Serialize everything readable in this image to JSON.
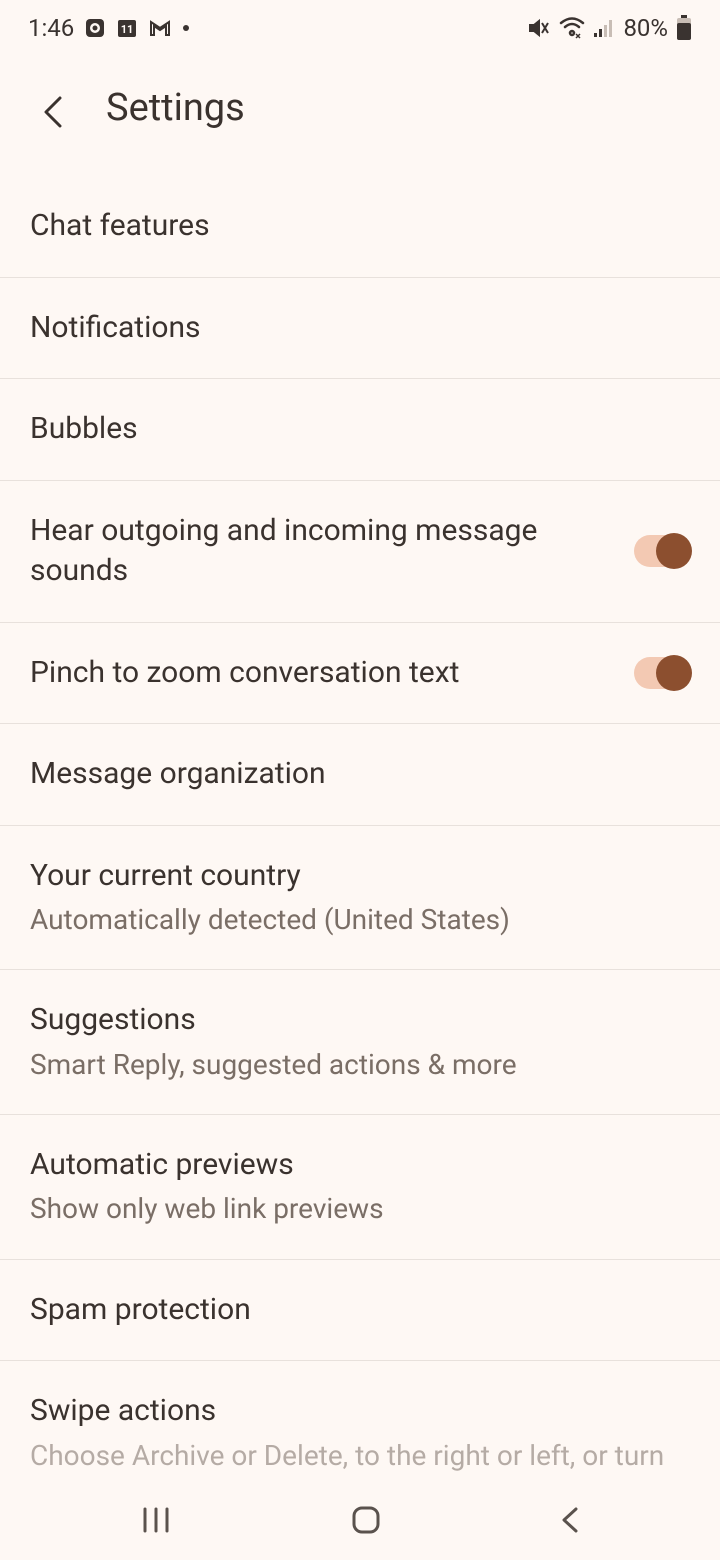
{
  "statusBar": {
    "time": "1:46",
    "battery": "80%"
  },
  "header": {
    "title": "Settings"
  },
  "settings": {
    "chatFeatures": {
      "title": "Chat features"
    },
    "notifications": {
      "title": "Notifications"
    },
    "bubbles": {
      "title": "Bubbles"
    },
    "sounds": {
      "title": "Hear outgoing and incoming message sounds",
      "toggle": true
    },
    "pinchZoom": {
      "title": "Pinch to zoom conversation text",
      "toggle": true
    },
    "messageOrg": {
      "title": "Message organization"
    },
    "country": {
      "title": "Your current country",
      "subtitle": "Automatically detected (United States)"
    },
    "suggestions": {
      "title": "Suggestions",
      "subtitle": "Smart Reply, suggested actions & more"
    },
    "previews": {
      "title": "Automatic previews",
      "subtitle": "Show only web link previews"
    },
    "spam": {
      "title": "Spam protection"
    },
    "swipe": {
      "title": "Swipe actions",
      "subtitle": "Choose Archive or Delete, to the right or left, or turn off swiping"
    }
  }
}
